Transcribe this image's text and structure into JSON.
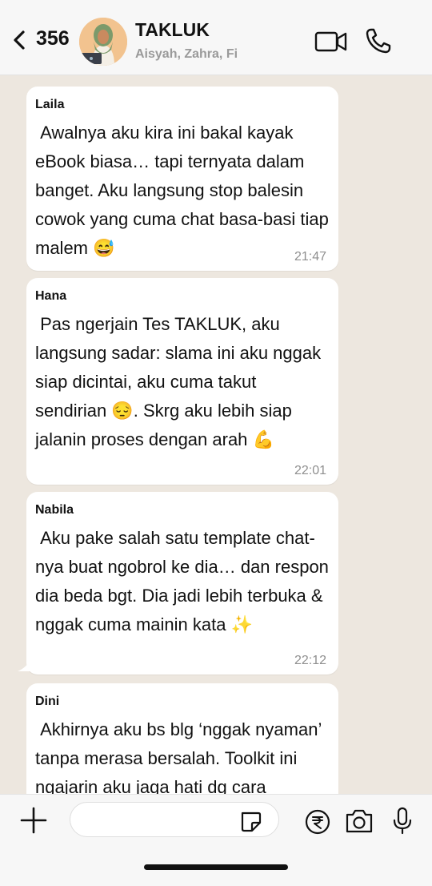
{
  "header": {
    "back_count": "356",
    "title": "TAKLUK",
    "subtitle": "Aisyah, Zahra, Fi"
  },
  "messages": [
    {
      "sender": "Laila",
      "text": " Awalnya aku kira ini bakal kayak eBook biasa… tapi ternyata dalam banget. Aku langsung stop balesin cowok yang cuma chat basa-basi tiap malem 😅",
      "time": "21:47"
    },
    {
      "sender": "Hana",
      "text": " Pas ngerjain Tes TAKLUK, aku langsung sadar: slama ini aku nggak siap dicintai, aku cuma takut sendirian 😔. Skrg aku lebih siap jalanin proses dengan arah 💪",
      "time": "22:01"
    },
    {
      "sender": "Nabila",
      "text": " Aku pake salah satu template chat-nya buat ngobrol ke dia… dan respon dia beda bgt. Dia jadi lebih terbuka & nggak cuma mainin kata ✨",
      "time": "22:12"
    },
    {
      "sender": "Dini",
      "text": " Akhirnya aku bs blg ‘nggak nyaman’ tanpa merasa bersalah. Toolkit ini ngajarin aku jaga hati dg cara",
      "time": ""
    }
  ],
  "composer": {
    "placeholder": ""
  }
}
